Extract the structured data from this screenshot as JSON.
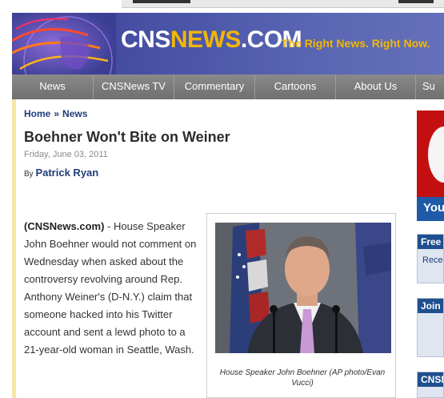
{
  "site": {
    "logo_cns": "CNS",
    "logo_news": "NEWS",
    "logo_com": ".COM",
    "tagline": "The Right News. Right Now.",
    "colors": {
      "header": "#4b55a8",
      "accent": "#f2b705",
      "nav": "#7a7a7a",
      "link": "#1f3d7a"
    }
  },
  "nav": {
    "items": [
      {
        "label": "News"
      },
      {
        "label": "CNSNews TV"
      },
      {
        "label": "Commentary"
      },
      {
        "label": "Cartoons"
      },
      {
        "label": "About Us"
      },
      {
        "label": "Su"
      }
    ]
  },
  "breadcrumb": {
    "home": "Home",
    "sep": "»",
    "section": "News"
  },
  "article": {
    "title": "Boehner Won't Bite on Weiner",
    "date": "Friday, June 03, 2011",
    "by_prefix": "By",
    "author": "Patrick Ryan",
    "source": "(CNSNews.com)",
    "body": " - House Speaker John Boehner would not comment on Wednesday when asked about the controversy revolving around Rep. Anthony Weiner's (D-N.Y.) claim that someone hacked into his Twitter account and sent a lewd photo to a 21-year-old woman in Seattle, Wash.",
    "photo_caption": "House Speaker John Boehner (AP photo/Evan Vucci)"
  },
  "sidebar": {
    "ad_text": "You",
    "box1_header": "Free C",
    "box1_body": "Rece",
    "box2_header": "Join C",
    "box3_header": "CNSN"
  }
}
